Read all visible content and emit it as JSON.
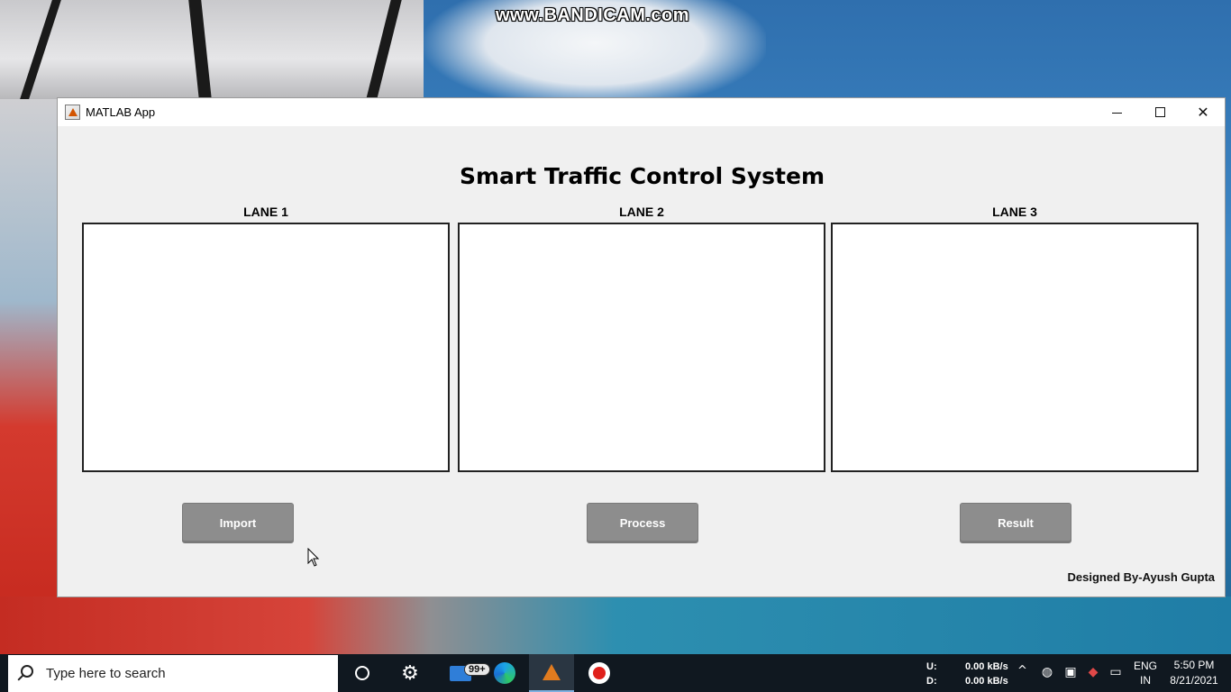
{
  "watermark": "www.BANDICAM.com",
  "window": {
    "title": "MATLAB App",
    "controls": {
      "minimize": "minimize",
      "maximize": "maximize",
      "close": "✕"
    }
  },
  "app": {
    "title": "Smart Traffic Control System",
    "lanes": [
      {
        "label": "LANE 1"
      },
      {
        "label": "LANE 2"
      },
      {
        "label": "LANE 3"
      }
    ],
    "buttons": {
      "import": "Import",
      "process": "Process",
      "result": "Result"
    },
    "credit": "Designed By-Ayush Gupta"
  },
  "taskbar": {
    "search_placeholder": "Type here to search",
    "mail_badge": "99+",
    "network": {
      "up_label": "U:",
      "down_label": "D:",
      "up_value": "0.00 kB/s",
      "down_value": "0.00 kB/s"
    },
    "language": {
      "line1": "ENG",
      "line2": "IN"
    },
    "clock": {
      "time": "5:50 PM",
      "date": "8/21/2021"
    }
  }
}
